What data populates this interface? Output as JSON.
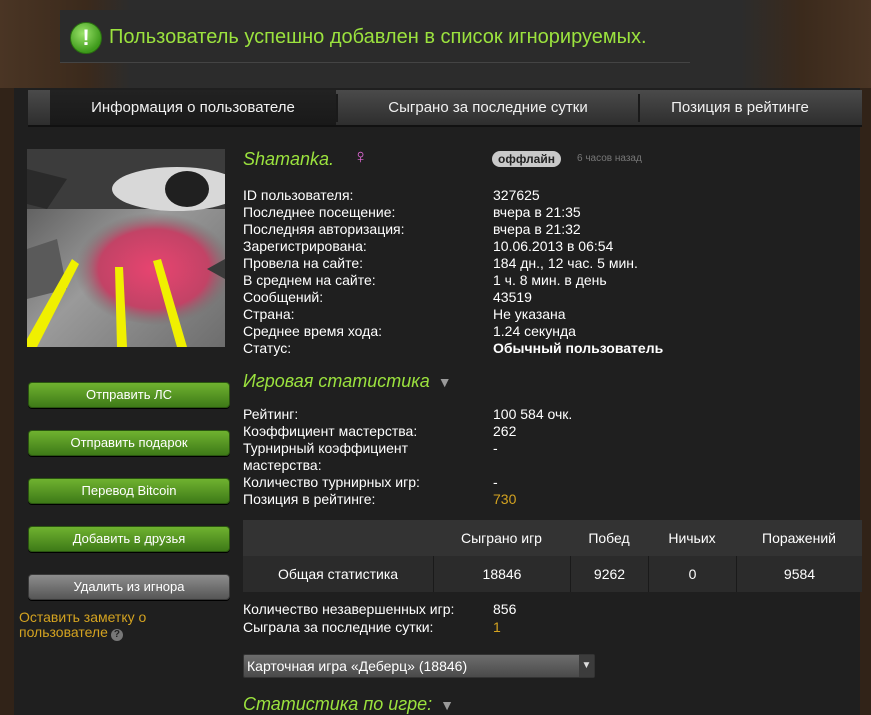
{
  "notice": {
    "icon": "exclamation-icon",
    "text": "Пользователь успешно добавлен в список игнорируемых."
  },
  "tabs": [
    {
      "label": "Информация о пользователе",
      "active": true
    },
    {
      "label": "Сыграно за последние сутки",
      "active": false
    },
    {
      "label": "Позиция в рейтинге",
      "active": false
    }
  ],
  "profile": {
    "username": "Shamanka.",
    "gender_icon": "♀",
    "status": "оффлайн",
    "status_time": "6 часов назад"
  },
  "info": [
    {
      "k": "ID пользователя:",
      "v": "327625"
    },
    {
      "k": "Последнее посещение:",
      "v": "вчера в 21:35"
    },
    {
      "k": "Последняя авторизация:",
      "v": "вчера в 21:32"
    },
    {
      "k": "Зарегистрирована:",
      "v": "10.06.2013 в 06:54"
    },
    {
      "k": "Провела на сайте:",
      "v": "184 дн., 12 час. 5 мин."
    },
    {
      "k": "В среднем на сайте:",
      "v": "1 ч. 8 мин. в день"
    },
    {
      "k": "Сообщений:",
      "v": "43519"
    },
    {
      "k": "Страна:",
      "v": "Не указана"
    },
    {
      "k": "Среднее время хода:",
      "v": "1.24 секунда"
    },
    {
      "k": "Статус:",
      "v": "Обычный пользователь"
    }
  ],
  "buttons": {
    "send_pm": "Отправить ЛС",
    "send_gift": "Отправить подарок",
    "bitcoin": "Перевод Bitcoin",
    "add_friend": "Добавить в друзья",
    "remove_ignore": "Удалить из игнора"
  },
  "note_link": "Оставить заметку о пользователе",
  "game_stats": {
    "title": "Игровая статистика",
    "rows": [
      {
        "k": "Рейтинг:",
        "v": "100 584 очк."
      },
      {
        "k": "Коэффициент мастерства:",
        "v": "262"
      },
      {
        "k": "Турнирный коэффициент мастерства:",
        "v": "-"
      },
      {
        "k": "Количество турнирных игр:",
        "v": "-"
      },
      {
        "k": "Позиция в рейтинге:",
        "v": "730"
      }
    ]
  },
  "table": {
    "headers": [
      "",
      "Сыграно игр",
      "Побед",
      "Ничьих",
      "Поражений"
    ],
    "row": [
      "Общая статистика",
      "18846",
      "9262",
      "0",
      "9584"
    ]
  },
  "extra": [
    {
      "k": "Количество незавершенных игр:",
      "v": "856"
    },
    {
      "k": "Сыграла за последние сутки:",
      "v": "1"
    }
  ],
  "game_select": "Карточная игра «Деберц» (18846)",
  "per_game_title": "Статистика по игре:"
}
